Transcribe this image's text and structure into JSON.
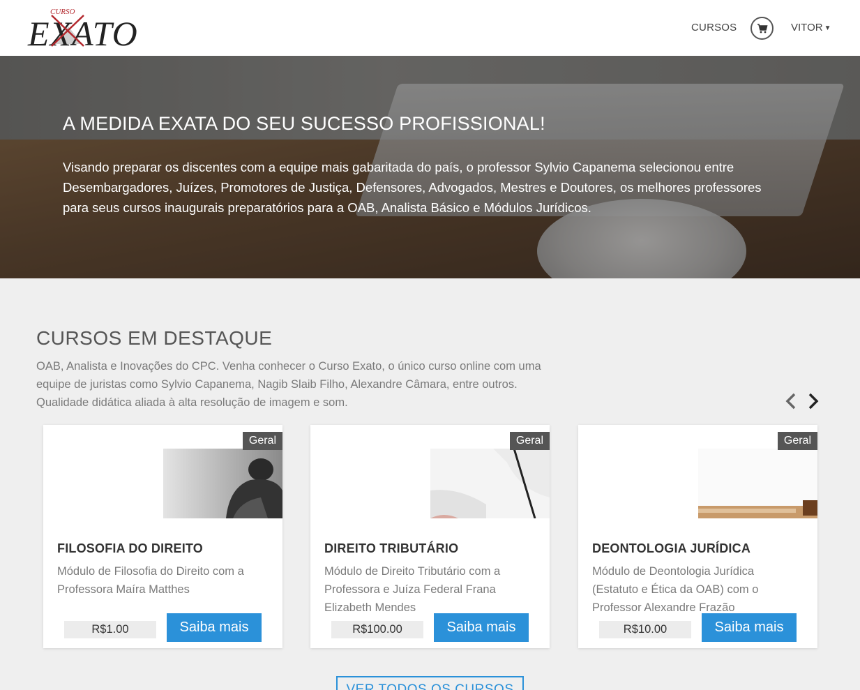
{
  "brand": {
    "logo_small": "CURSO",
    "logo_main": "EXATO"
  },
  "nav": {
    "courses_label": "CURSOS",
    "user_label": "VITOR"
  },
  "hero": {
    "title": "A MEDIDA EXATA DO SEU SUCESSO PROFISSIONAL!",
    "text": "Visando preparar os discentes com a equipe mais gabaritada do país, o professor Sylvio Capanema selecionou entre Desembargadores, Juízes, Promotores de Justiça, Defensores, Advogados, Mestres e Doutores, os melhores professores para seus cursos inaugurais preparatórios para a OAB, Analista Básico e Módulos Jurídicos."
  },
  "featured": {
    "title": "CURSOS EM DESTAQUE",
    "description": "OAB, Analista e Inovações do CPC. Venha conhecer o Curso Exato, o único curso online com uma equipe de juristas como Sylvio Capanema, Nagib Slaib Filho, Alexandre Câmara, entre outros. Qualidade didática aliada à alta resolução de imagem e som.",
    "see_all_label": "VER TODOS OS CURSOS",
    "cards": [
      {
        "badge": "Geral",
        "title": "FILOSOFIA DO DIREITO",
        "description": "Módulo de Filosofia do Direito com a Professora Maíra Matthes",
        "price": "R$1.00",
        "button": "Saiba mais",
        "image": "thinker-statue"
      },
      {
        "badge": "Geral",
        "title": "DIREITO TRIBUTÁRIO",
        "description": "Módulo de Direito Tributário com a Professora e Juíza Federal Frana Elizabeth Mendes",
        "price": "R$100.00",
        "button": "Saiba mais",
        "image": "hands-papers"
      },
      {
        "badge": "Geral",
        "title": "DEONTOLOGIA JURÍDICA",
        "description": "Módulo de Deontologia Jurídica (Estatuto e Ética da OAB) com o Professor Alexandre Frazão",
        "price": "R$10.00",
        "button": "Saiba mais",
        "image": "gavel"
      }
    ]
  },
  "colors": {
    "accent": "#2b91d9",
    "badge_bg": "#555555",
    "logo_red": "#b3282d"
  }
}
